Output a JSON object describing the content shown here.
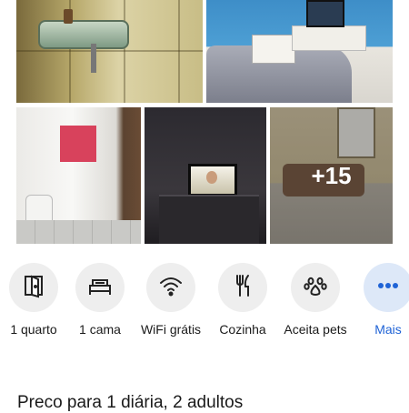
{
  "photos": {
    "more_label": "+15"
  },
  "amenities": [
    {
      "label": "1 quarto",
      "icon": "door-icon"
    },
    {
      "label": "1 cama",
      "icon": "bed-icon"
    },
    {
      "label": "WiFi grátis",
      "icon": "wifi-icon"
    },
    {
      "label": "Cozinha",
      "icon": "cutlery-icon"
    },
    {
      "label": "Aceita pets",
      "icon": "paw-icon"
    },
    {
      "label": "Mais",
      "icon": "more-dots-icon"
    }
  ],
  "price": {
    "label": "Preco para 1 diária, 2 adultos"
  },
  "colors": {
    "accent": "#1f63d6",
    "icon_bg": "#eeeeee",
    "accent_bg": "#dde8f8"
  }
}
